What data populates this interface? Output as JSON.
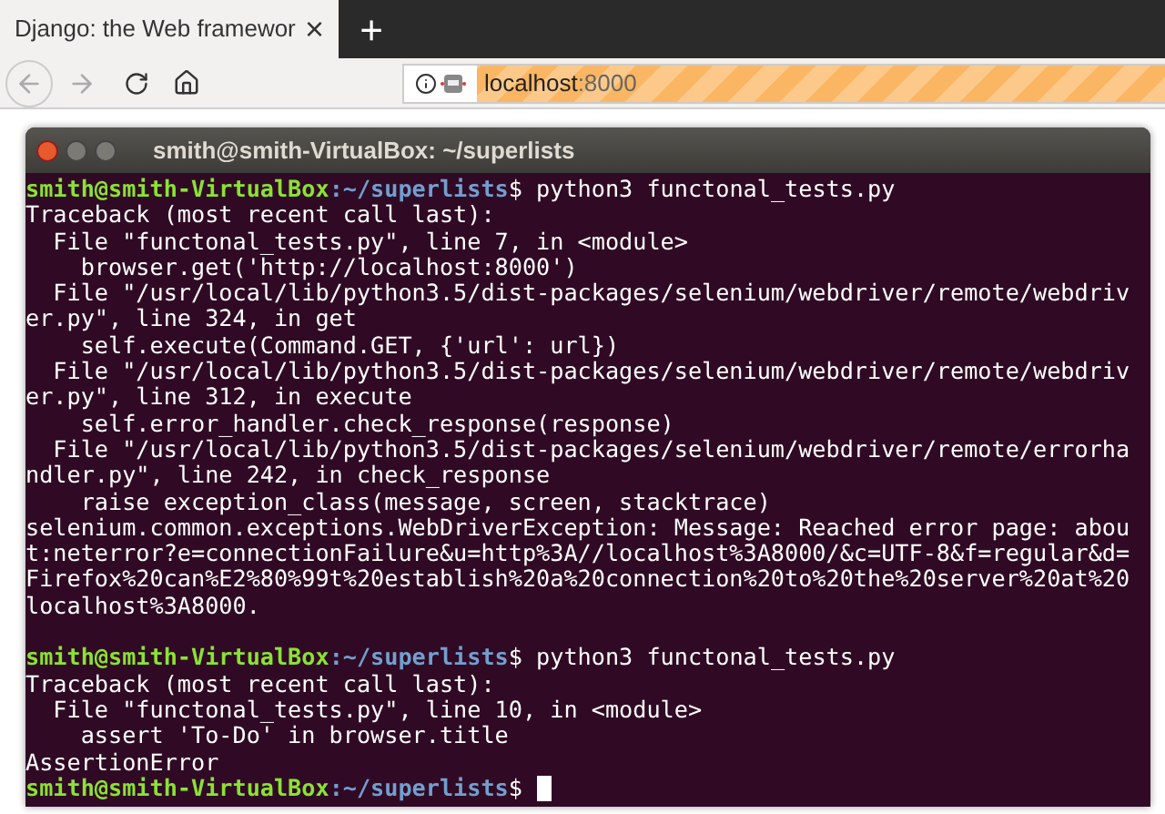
{
  "browser": {
    "tab": {
      "title": "Django: the Web framewor",
      "selected": true,
      "close": "×"
    },
    "new_tab": "+",
    "address": {
      "host": "localhost",
      "port": ":8000"
    }
  },
  "terminal": {
    "title": "smith@smith-VirtualBox: ~/superlists",
    "lines": [
      {
        "kind": "prompt",
        "user": "smith@smith-VirtualBox",
        "path": ":~/superlists",
        "command": "$ python3 functonal_tests.py"
      },
      {
        "kind": "output",
        "text": "Traceback (most recent call last):"
      },
      {
        "kind": "output",
        "text": "  File \"functonal_tests.py\", line 7, in <module>"
      },
      {
        "kind": "output",
        "text": "    browser.get('http://localhost:8000')"
      },
      {
        "kind": "output",
        "text": "  File \"/usr/local/lib/python3.5/dist-packages/selenium/webdriver/remote/webdriv"
      },
      {
        "kind": "output",
        "text": "er.py\", line 324, in get"
      },
      {
        "kind": "output",
        "text": "    self.execute(Command.GET, {'url': url})"
      },
      {
        "kind": "output",
        "text": "  File \"/usr/local/lib/python3.5/dist-packages/selenium/webdriver/remote/webdriv"
      },
      {
        "kind": "output",
        "text": "er.py\", line 312, in execute"
      },
      {
        "kind": "output",
        "text": "    self.error_handler.check_response(response)"
      },
      {
        "kind": "output",
        "text": "  File \"/usr/local/lib/python3.5/dist-packages/selenium/webdriver/remote/errorha"
      },
      {
        "kind": "output",
        "text": "ndler.py\", line 242, in check_response"
      },
      {
        "kind": "output",
        "text": "    raise exception_class(message, screen, stacktrace)"
      },
      {
        "kind": "output",
        "text": "selenium.common.exceptions.WebDriverException: Message: Reached error page: abou"
      },
      {
        "kind": "output",
        "text": "t:neterror?e=connectionFailure&u=http%3A//localhost%3A8000/&c=UTF-8&f=regular&d="
      },
      {
        "kind": "output",
        "text": "Firefox%20can%E2%80%99t%20establish%20a%20connection%20to%20the%20server%20at%20"
      },
      {
        "kind": "output",
        "text": "localhost%3A8000."
      },
      {
        "kind": "blank"
      },
      {
        "kind": "prompt",
        "user": "smith@smith-VirtualBox",
        "path": ":~/superlists",
        "command": "$ python3 functonal_tests.py"
      },
      {
        "kind": "output",
        "text": "Traceback (most recent call last):"
      },
      {
        "kind": "output",
        "text": "  File \"functonal_tests.py\", line 10, in <module>"
      },
      {
        "kind": "output",
        "text": "    assert 'To-Do' in browser.title"
      },
      {
        "kind": "output",
        "text": "AssertionError"
      },
      {
        "kind": "prompt",
        "user": "smith@smith-VirtualBox",
        "path": ":~/superlists",
        "command": "$ ",
        "cursor": true
      }
    ]
  }
}
